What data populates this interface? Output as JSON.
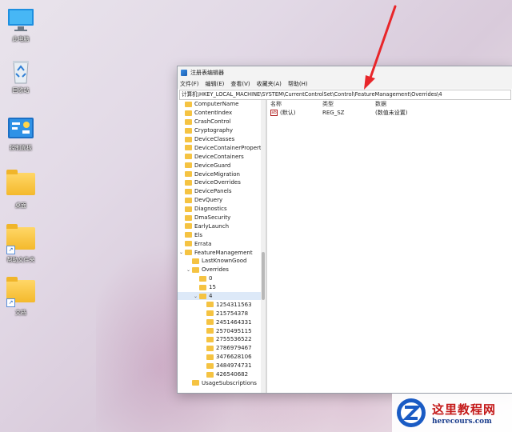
{
  "desktop": {
    "icons": [
      {
        "label": "此电脑",
        "icon": "monitor-icon"
      },
      {
        "label": "回收站",
        "icon": "recycle-bin-icon"
      },
      {
        "label": "控制面板",
        "icon": "control-panel-icon"
      },
      {
        "label": "桌面",
        "icon": "folder-icon"
      },
      {
        "label": "帮助文件夹",
        "icon": "folder-shortcut-icon"
      },
      {
        "label": "文档",
        "icon": "folder-shortcut-icon"
      }
    ]
  },
  "window": {
    "title": "注册表编辑器",
    "menu": [
      "文件(F)",
      "编辑(E)",
      "查看(V)",
      "收藏夹(A)",
      "帮助(H)"
    ],
    "address": "计算机\\HKEY_LOCAL_MACHINE\\SYSTEM\\CurrentControlSet\\Control\\FeatureManagement\\Overrides\\4",
    "tree": [
      {
        "label": "ComputerName",
        "level": 0
      },
      {
        "label": "ContentIndex",
        "level": 0
      },
      {
        "label": "CrashControl",
        "level": 0
      },
      {
        "label": "Cryptography",
        "level": 0
      },
      {
        "label": "DeviceClasses",
        "level": 0
      },
      {
        "label": "DeviceContainerPropertyUpda",
        "level": 0
      },
      {
        "label": "DeviceContainers",
        "level": 0
      },
      {
        "label": "DeviceGuard",
        "level": 0
      },
      {
        "label": "DeviceMigration",
        "level": 0
      },
      {
        "label": "DeviceOverrides",
        "level": 0
      },
      {
        "label": "DevicePanels",
        "level": 0
      },
      {
        "label": "DevQuery",
        "level": 0
      },
      {
        "label": "Diagnostics",
        "level": 0
      },
      {
        "label": "DmaSecurity",
        "level": 0
      },
      {
        "label": "EarlyLaunch",
        "level": 0
      },
      {
        "label": "Els",
        "level": 0
      },
      {
        "label": "Errata",
        "level": 0
      },
      {
        "label": "FeatureManagement",
        "level": 0,
        "expanded": true
      },
      {
        "label": "LastKnownGood",
        "level": 1
      },
      {
        "label": "Overrides",
        "level": 1,
        "expanded": true
      },
      {
        "label": "0",
        "level": 2
      },
      {
        "label": "15",
        "level": 2
      },
      {
        "label": "4",
        "level": 2,
        "expanded": true,
        "selected": true
      },
      {
        "label": "1254311563",
        "level": 3
      },
      {
        "label": "215754378",
        "level": 3
      },
      {
        "label": "2451464331",
        "level": 3
      },
      {
        "label": "2570495115",
        "level": 3
      },
      {
        "label": "2755536522",
        "level": 3
      },
      {
        "label": "2786979467",
        "level": 3
      },
      {
        "label": "3476628106",
        "level": 3
      },
      {
        "label": "3484974731",
        "level": 3
      },
      {
        "label": "426540682",
        "level": 3
      },
      {
        "label": "UsageSubscriptions",
        "level": 1
      }
    ],
    "columns": {
      "name": "名称",
      "type": "类型",
      "data": "数据"
    },
    "values": [
      {
        "name": "(默认)",
        "type": "REG_SZ",
        "data": "(数值未设置)"
      }
    ]
  },
  "watermark": {
    "title": "这里教程网",
    "url": "herecours.com"
  },
  "colors": {
    "arrow": "#e8262a",
    "folder": "#f5c342",
    "accent": "#1c5fb0"
  }
}
